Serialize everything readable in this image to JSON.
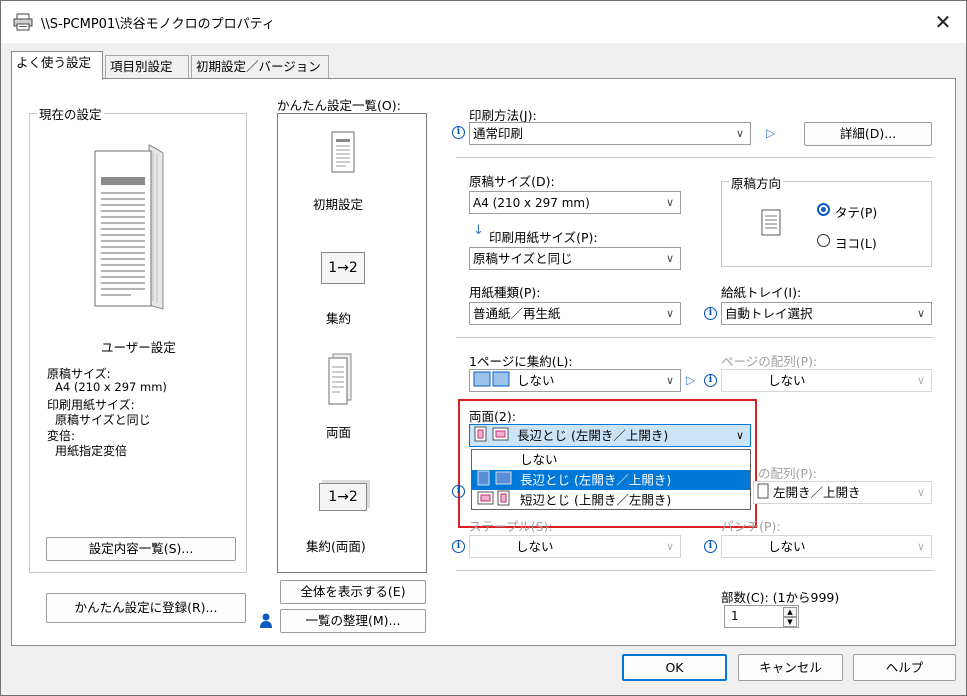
{
  "window": {
    "title": "\\\\S-PCMP01\\渋谷モノクロのプロパティ",
    "close_glyph": "✕"
  },
  "tabs": [
    "よく使う設定",
    "項目別設定",
    "初期設定／バージョン"
  ],
  "current_settings": {
    "group_label": "現在の設定",
    "profile_name": "ユーザー設定",
    "lines": [
      "原稿サイズ:",
      "A4 (210 x 297 mm)",
      "印刷用紙サイズ:",
      "原稿サイズと同じ",
      "変倍:",
      "用紙指定変倍"
    ],
    "list_button": "設定内容一覧(S)...",
    "register_button": "かんたん設定に登録(R)..."
  },
  "easy_settings": {
    "label": "かんたん設定一覧(O):",
    "items": [
      {
        "label": "初期設定",
        "icon": "document-icon"
      },
      {
        "label": "集約",
        "icon": "two-up-icon",
        "badge": "1→2"
      },
      {
        "label": "両面",
        "icon": "duplex-icon"
      },
      {
        "label": "集約(両面)",
        "icon": "two-up-duplex-icon",
        "badge": "1→2"
      }
    ],
    "show_all_button": "全体を表示する(E)",
    "organize_button": "一覧の整理(M)..."
  },
  "print_method": {
    "label": "印刷方法(J):",
    "value": "通常印刷",
    "detail_button": "詳細(D)..."
  },
  "original_size": {
    "label": "原稿サイズ(D):",
    "value": "A4 (210 x 297 mm)"
  },
  "paper_size": {
    "label": "印刷用紙サイズ(P):",
    "value": "原稿サイズと同じ"
  },
  "orientation": {
    "label": "原稿方向",
    "options": [
      "タテ(P)",
      "ヨコ(L)"
    ],
    "selected": "タテ(P)"
  },
  "paper_type": {
    "label": "用紙種類(P):",
    "value": "普通紙／再生紙"
  },
  "paper_tray": {
    "label": "給紙トレイ(I):",
    "value": "自動トレイ選択"
  },
  "pages_per_sheet": {
    "label": "1ページに集約(L):",
    "value": "しない"
  },
  "page_order": {
    "label": "ページの配列(P):",
    "value": "しない"
  },
  "duplex": {
    "label": "両面(2):",
    "value": "長辺とじ (左開き／上開き)",
    "options": [
      "しない",
      "長辺とじ (左開き／上開き)",
      "短辺とじ (上開き／左開き)"
    ],
    "selected_index": 1
  },
  "duplex_order": {
    "label": "の配列(P):",
    "value": "左開き／上開き"
  },
  "staple": {
    "label": "ステープル(S):",
    "value": "しない"
  },
  "punch": {
    "label": "パンチ(P):",
    "value": "しない"
  },
  "copies": {
    "label": "部数(C): (1から999)",
    "value": "1"
  },
  "footer": {
    "ok": "OK",
    "cancel": "キャンセル",
    "help": "ヘルプ"
  },
  "colors": {
    "accent": "#0078d7",
    "highlight_box": "#e02020",
    "info_icon": "#0050b4"
  }
}
